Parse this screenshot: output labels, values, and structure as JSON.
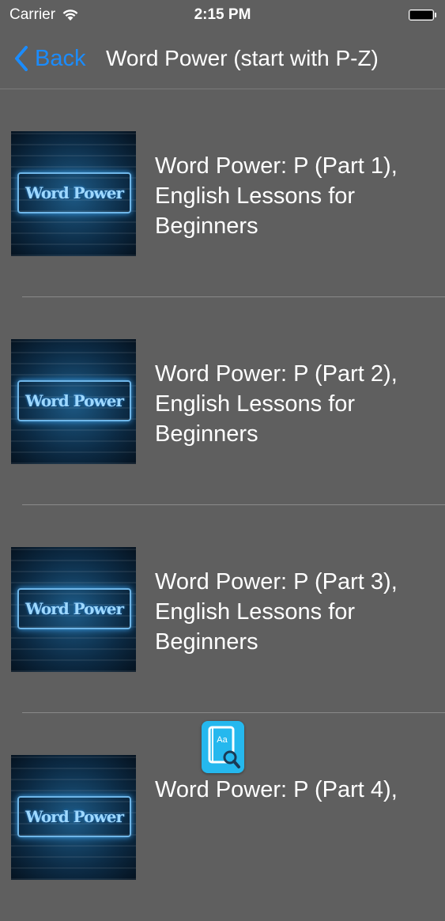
{
  "status_bar": {
    "carrier": "Carrier",
    "time": "2:15 PM"
  },
  "nav": {
    "back_label": "Back",
    "title": "Word Power (start with P-Z)"
  },
  "list": {
    "items": [
      {
        "thumbnail_text": "Word Power",
        "title": "Word Power:  P (Part 1),\nEnglish Lessons for\nBeginners"
      },
      {
        "thumbnail_text": "Word Power",
        "title": "Word Power:  P (Part 2),\nEnglish Lessons for\nBeginners"
      },
      {
        "thumbnail_text": "Word Power",
        "title": "Word Power:  P (Part 3),\nEnglish  Lessons for\nBeginners"
      },
      {
        "thumbnail_text": "Word Power",
        "title": "Word Power:  P (Part 4),"
      }
    ]
  },
  "floating_icon": {
    "text": "Aa",
    "icon": "dictionary-search-icon"
  },
  "colors": {
    "background": "#5f5f5f",
    "accent": "#1a8cff",
    "icon_bg": "#25b8ee"
  }
}
